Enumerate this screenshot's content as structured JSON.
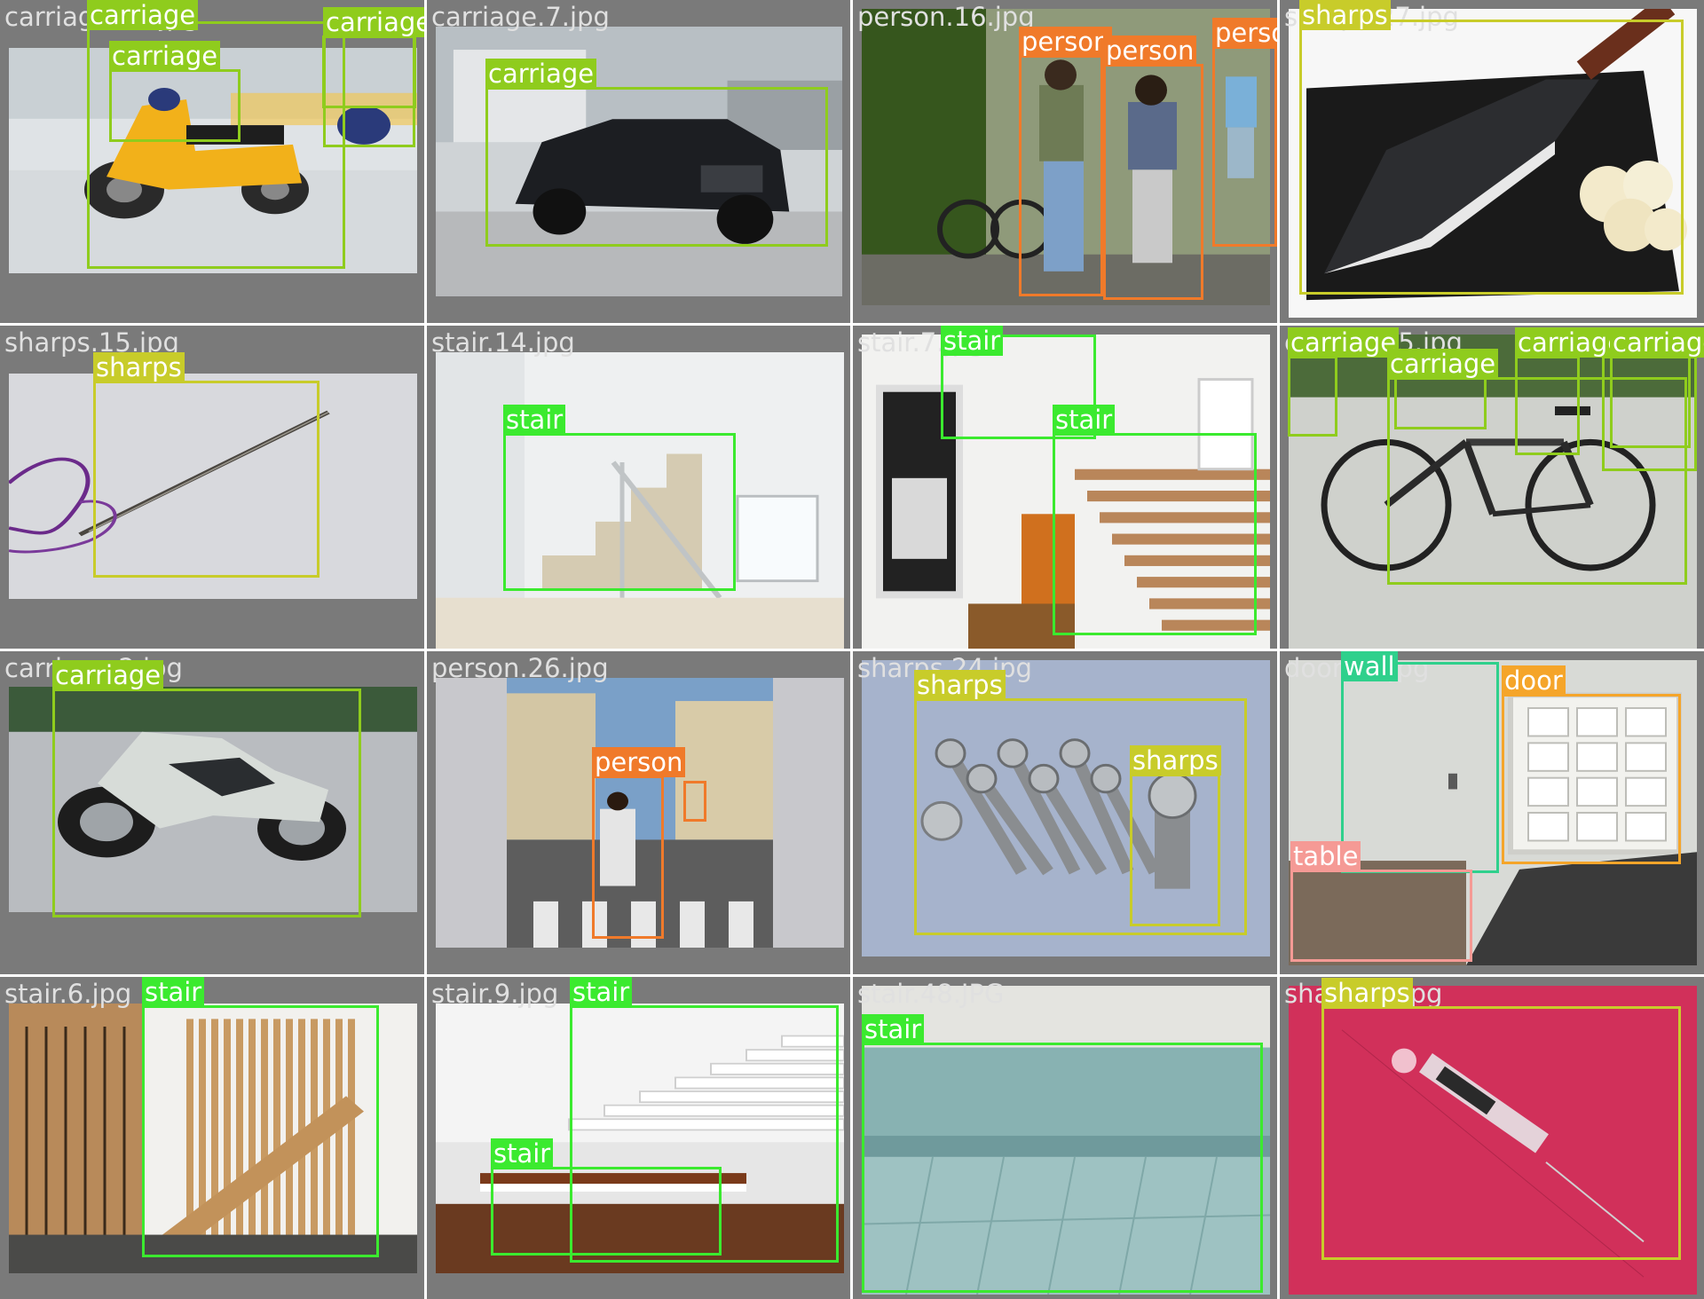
{
  "grid": {
    "columns": 4,
    "rows": 4
  },
  "class_colors": {
    "carriage": "#8fcc1d",
    "person": "#f07a2a",
    "sharps": "#c8cc2a",
    "stair": "#3bea2f",
    "wall": "#2fd08c",
    "door": "#f5a52a",
    "table": "#f59a95"
  },
  "tiles": [
    {
      "filename": "carriage.29.jpg",
      "scene": "scooter",
      "detections": [
        {
          "label": "carriage",
          "class": "carriage"
        },
        {
          "label": "carriage",
          "class": "carriage"
        },
        {
          "label": "carriage",
          "class": "carriage"
        },
        {
          "label": "carriage",
          "class": "carriage"
        }
      ]
    },
    {
      "filename": "carriage.7.jpg",
      "scene": "suv",
      "detections": [
        {
          "label": "carriage",
          "class": "carriage"
        }
      ]
    },
    {
      "filename": "person.16.jpg",
      "scene": "walkers",
      "detections": [
        {
          "label": "person",
          "class": "person"
        },
        {
          "label": "person",
          "class": "person"
        },
        {
          "label": "person",
          "class": "person"
        }
      ]
    },
    {
      "filename": "sharps.27.jpg",
      "scene": "knife",
      "detections": [
        {
          "label": "sharps",
          "class": "sharps"
        }
      ]
    },
    {
      "filename": "sharps.15.jpg",
      "scene": "needle",
      "detections": [
        {
          "label": "sharps",
          "class": "sharps"
        }
      ]
    },
    {
      "filename": "stair.14.jpg",
      "scene": "stair-rail",
      "detections": [
        {
          "label": "stair",
          "class": "stair"
        }
      ]
    },
    {
      "filename": "stair.7.jpg",
      "scene": "stair-hall",
      "detections": [
        {
          "label": "stair",
          "class": "stair"
        },
        {
          "label": "stair",
          "class": "stair"
        }
      ]
    },
    {
      "filename": "carriage.5.jpg",
      "scene": "bicycle",
      "detections": [
        {
          "label": "carriage",
          "class": "carriage"
        },
        {
          "label": "carriage",
          "class": "carriage"
        },
        {
          "label": "carriage",
          "class": "carriage"
        },
        {
          "label": "carriage",
          "class": "carriage"
        },
        {
          "label": "carriage",
          "class": "carriage"
        },
        {
          "label": "carriage",
          "class": "carriage"
        }
      ]
    },
    {
      "filename": "carriage.2.jpg",
      "scene": "motorbike",
      "detections": [
        {
          "label": "carriage",
          "class": "carriage"
        }
      ]
    },
    {
      "filename": "person.26.jpg",
      "scene": "street",
      "detections": [
        {
          "label": "person",
          "class": "person"
        },
        {
          "label": "person",
          "class": "person"
        }
      ]
    },
    {
      "filename": "sharps.24.jpg",
      "scene": "screws",
      "detections": [
        {
          "label": "sharps",
          "class": "sharps"
        },
        {
          "label": "sharps",
          "class": "sharps"
        }
      ]
    },
    {
      "filename": "door.22.jpg",
      "scene": "room",
      "detections": [
        {
          "label": "wall",
          "class": "wall"
        },
        {
          "label": "door",
          "class": "door"
        },
        {
          "label": "table",
          "class": "table"
        }
      ]
    },
    {
      "filename": "stair.6.jpg",
      "scene": "stair-wood",
      "detections": [
        {
          "label": "stair",
          "class": "stair"
        }
      ]
    },
    {
      "filename": "stair.9.jpg",
      "scene": "stair-white",
      "detections": [
        {
          "label": "stair",
          "class": "stair"
        },
        {
          "label": "stair",
          "class": "stair"
        }
      ]
    },
    {
      "filename": "stair.48.JPG",
      "scene": "steps",
      "detections": [
        {
          "label": "stair",
          "class": "stair"
        }
      ]
    },
    {
      "filename": "sharps.3.jpg",
      "scene": "syringe",
      "detections": [
        {
          "label": "sharps",
          "class": "sharps"
        }
      ]
    }
  ]
}
